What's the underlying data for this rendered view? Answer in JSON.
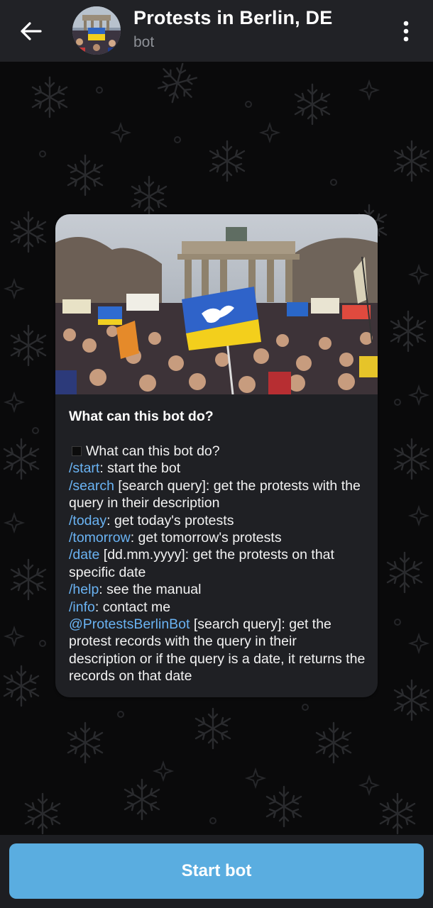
{
  "header": {
    "title": "Protests in Berlin, DE",
    "subtitle": "bot",
    "back_icon": "arrow-left-icon",
    "menu_icon": "more-vertical-icon"
  },
  "card": {
    "heading": "What can this bot do?",
    "lines": [
      {
        "prefix": "",
        "cmd": "",
        "text": "What can this bot do?",
        "has_square": true
      },
      {
        "cmd": "/start",
        "text": ": start the bot"
      },
      {
        "cmd": "/search",
        "text": " [search query]: get the protests with the query in their description"
      },
      {
        "cmd": "/today",
        "text": ": get today's protests"
      },
      {
        "cmd": "/tomorrow",
        "text": ": get tomorrow's protests"
      },
      {
        "cmd": "/date",
        "text": " [dd.mm.yyyy]: get the protests on that specific date"
      },
      {
        "cmd": "/help",
        "text": ": see the manual"
      },
      {
        "cmd": "/info",
        "text": ": contact me"
      },
      {
        "cmd": "@ProtestsBerlinBot",
        "text": " [search query]: get the protest records with the query in their description or if the query is a date, it returns the records on that date"
      }
    ]
  },
  "footer": {
    "start_label": "Start bot"
  },
  "colors": {
    "accent": "#5aade0",
    "link": "#6ab3f3",
    "topbar": "#212226",
    "card": "#1f2024"
  }
}
